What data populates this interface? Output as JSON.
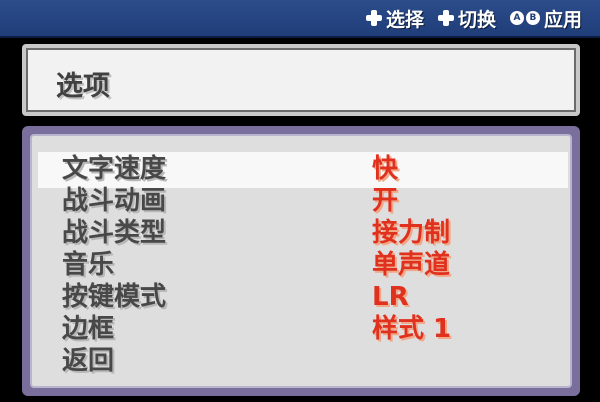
{
  "topbar": {
    "hint_select": "选择",
    "hint_switch": "切换",
    "hint_apply": "应用",
    "btn_a": "A",
    "btn_b": "B"
  },
  "title": "选项",
  "options": [
    {
      "label": "文字速度",
      "value": "快"
    },
    {
      "label": "战斗动画",
      "value": "开"
    },
    {
      "label": "战斗类型",
      "value": "接力制"
    },
    {
      "label": "音乐",
      "value": "单声道"
    },
    {
      "label": "按键模式",
      "value": "LR"
    },
    {
      "label": "边框",
      "value": "样式 1"
    },
    {
      "label": "返回",
      "value": ""
    }
  ],
  "colors": {
    "topbar": "#1f3e7a",
    "value_text": "#e0301e",
    "frame": "#7a6f9c"
  }
}
